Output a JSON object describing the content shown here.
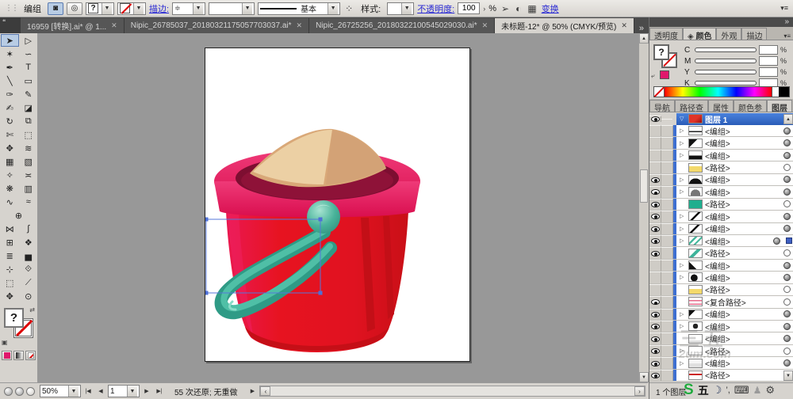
{
  "colors": {
    "accent_blue": "#316ac5",
    "link_blue": "#2a2ad4",
    "tab_dark": "#4b4b4b",
    "panel_bg": "#d6d3ce",
    "selected_row_blue": "#2a5cb8",
    "canvas_gray": "#989898",
    "bucket_red": "#e6131f",
    "rim_pink": "#e41158",
    "handle_teal": "#3fae96",
    "sand_tan": "#e3bd8e",
    "swatch_magenta": "#e0186c"
  },
  "control_bar": {
    "grip": "⋮⋮",
    "selection_label": "编组",
    "fill_proxy": "?",
    "stroke_link": "描边:",
    "stroke_weight_icon": "≑",
    "brush_name": "基本",
    "dots_icon": "⁘",
    "style_label": "样式:",
    "opacity_link": "不透明度:",
    "opacity_value": "100",
    "opacity_stepper": "›",
    "percent": "%",
    "pointer_icon": "➢",
    "sphere_icon": "◐",
    "checker_icon": "▦",
    "transform_link": "变换",
    "menu_icon": "▾≡"
  },
  "tab_bar": {
    "stub": "❝",
    "overflow": "»",
    "close_glyph": "✕",
    "documents": [
      {
        "label": "16959 [转换].ai* @ 1...",
        "active": false
      },
      {
        "label": "Nipic_26785037_20180321175057703037.ai*",
        "active": false
      },
      {
        "label": "Nipic_26725256_20180322100545029030.ai*",
        "active": false
      },
      {
        "label": "未标题-12* @ 50% (CMYK/预览)",
        "active": true
      }
    ]
  },
  "toolbar": {
    "rows": [
      {
        "left": {
          "name": "selection-tool",
          "glyph": "➤",
          "active": true
        },
        "right": {
          "name": "direct-selection-tool",
          "glyph": "▷"
        }
      },
      {
        "left": {
          "name": "magic-wand-tool",
          "glyph": "✶"
        },
        "right": {
          "name": "lasso-tool",
          "glyph": "∽"
        }
      },
      {
        "left": {
          "name": "pen-tool",
          "glyph": "✒"
        },
        "right": {
          "name": "type-tool",
          "glyph": "T"
        }
      },
      {
        "left": {
          "name": "line-segment-tool",
          "glyph": "╲"
        },
        "right": {
          "name": "rectangle-tool",
          "glyph": "▭"
        }
      },
      {
        "left": {
          "name": "paintbrush-tool",
          "glyph": "✑"
        },
        "right": {
          "name": "pencil-tool",
          "glyph": "✎"
        }
      },
      {
        "left": {
          "name": "blob-brush-tool",
          "glyph": "✍"
        },
        "right": {
          "name": "eraser-tool",
          "glyph": "◪"
        }
      },
      {
        "left": {
          "name": "rotate-tool",
          "glyph": "↻"
        },
        "right": {
          "name": "reflect-tool",
          "glyph": "⧉"
        }
      },
      {
        "left": {
          "name": "scissors-tool",
          "glyph": "✄"
        },
        "right": {
          "name": "free-transform-tool",
          "glyph": "⬚"
        }
      },
      {
        "left": {
          "name": "warp-tool",
          "glyph": "✥"
        },
        "right": {
          "name": "width-tool",
          "glyph": "≋"
        }
      },
      {
        "left": {
          "name": "mesh-tool",
          "glyph": "▦"
        },
        "right": {
          "name": "gradient-tool",
          "glyph": "▧"
        }
      },
      {
        "left": {
          "name": "eyedropper-tool",
          "glyph": "✧"
        },
        "right": {
          "name": "blend-tool",
          "glyph": "≍"
        }
      },
      {
        "left": {
          "name": "symbol-sprayer-tool",
          "glyph": "❋"
        },
        "right": {
          "name": "column-graph-tool",
          "glyph": "▥"
        }
      },
      {
        "left": {
          "name": "knife-tool",
          "glyph": "∿"
        },
        "right": {
          "name": "wave-tool",
          "glyph": "≈"
        }
      },
      {
        "single": {
          "name": "crosshair-tool",
          "glyph": "⊕"
        }
      },
      {
        "left": {
          "name": "envelope-tool",
          "glyph": "⋈"
        },
        "right": {
          "name": "arc-tool",
          "glyph": "∫"
        }
      },
      {
        "left": {
          "name": "grid-tool",
          "glyph": "⊞"
        },
        "right": {
          "name": "shape-builder-tool",
          "glyph": "❖"
        }
      },
      {
        "left": {
          "name": "scribble-tool",
          "glyph": "≣"
        },
        "right": {
          "name": "bar-graph-tool",
          "glyph": "▅"
        }
      },
      {
        "left": {
          "name": "measure-tool",
          "glyph": "⊹"
        },
        "right": {
          "name": "live-paint-tool",
          "glyph": "⟐"
        }
      },
      {
        "left": {
          "name": "marquee-tool",
          "glyph": "⬚"
        },
        "right": {
          "name": "slice-tool",
          "glyph": "⟋"
        }
      },
      {
        "left": {
          "name": "hand-tool",
          "glyph": "✥"
        },
        "right": {
          "name": "zoom-tool",
          "glyph": "⊙"
        }
      }
    ],
    "fill_proxy": "?",
    "swap_icon": "⇄",
    "mini_icon": "▣"
  },
  "statusbar": {
    "zoom_value": "50%",
    "nav_first": "|◀",
    "nav_prev": "◀",
    "artboard_value": "1",
    "nav_next": "▶",
    "nav_last": "▶|",
    "status_text": "55 次还原; 无重做",
    "status_more": "▶",
    "hscroll_left": "‹",
    "hscroll_right": "›",
    "vscroll_up": "▲",
    "vscroll_down": "▼"
  },
  "dock": {
    "overflow": "»",
    "menu_icon": "▾≡",
    "group1_tabs": [
      {
        "label": "透明度",
        "active": false
      },
      {
        "label": "颜色",
        "active": true,
        "icon": "◈"
      },
      {
        "label": "外观",
        "active": false
      },
      {
        "label": "描边",
        "active": false
      }
    ],
    "color_panel": {
      "fill_proxy": "?",
      "swap_icon": "⤶",
      "channels": [
        {
          "label": "C",
          "value": "",
          "unit": "%"
        },
        {
          "label": "M",
          "value": "",
          "unit": "%"
        },
        {
          "label": "Y",
          "value": "",
          "unit": "%"
        },
        {
          "label": "K",
          "value": "",
          "unit": "%"
        }
      ]
    },
    "group2_tabs": [
      {
        "label": "导航",
        "active": false
      },
      {
        "label": "路径查",
        "active": false
      },
      {
        "label": "属性",
        "active": false
      },
      {
        "label": "颜色参",
        "active": false
      },
      {
        "label": "图层",
        "active": true
      }
    ],
    "layers": {
      "header": {
        "name": "图层 1",
        "expand": "▽"
      },
      "expand_glyph": "▷",
      "items": [
        {
          "label": "<编组>",
          "eye": false,
          "expand": true,
          "thumb": "white-line",
          "target": "filled"
        },
        {
          "label": "<编组>",
          "eye": false,
          "expand": true,
          "thumb": "black-wedge",
          "target": "filled"
        },
        {
          "label": "<编组>",
          "eye": false,
          "expand": true,
          "thumb": "black-bottom",
          "target": "filled"
        },
        {
          "label": "<路径>",
          "eye": false,
          "expand": false,
          "thumb": "yellow",
          "target": "open"
        },
        {
          "label": "<编组>",
          "eye": true,
          "expand": true,
          "thumb": "black-crescent",
          "target": "filled"
        },
        {
          "label": "<编组>",
          "eye": true,
          "expand": true,
          "thumb": "gray-blob",
          "target": "filled"
        },
        {
          "label": "<路径>",
          "eye": true,
          "expand": false,
          "thumb": "teal",
          "target": "open"
        },
        {
          "label": "<编组>",
          "eye": true,
          "expand": true,
          "thumb": "diag-line",
          "target": "filled"
        },
        {
          "label": "<编组>",
          "eye": true,
          "expand": true,
          "thumb": "diag-line2",
          "target": "filled"
        },
        {
          "label": "<编组>",
          "eye": true,
          "expand": true,
          "thumb": "teal-marks",
          "target": "filled",
          "selected": true
        },
        {
          "label": "<路径>",
          "eye": true,
          "expand": false,
          "thumb": "teal-diag",
          "target": "open"
        },
        {
          "label": "<编组>",
          "eye": false,
          "expand": true,
          "thumb": "black-wedge2",
          "target": "filled"
        },
        {
          "label": "<编组>",
          "eye": false,
          "expand": true,
          "thumb": "black-blob",
          "target": "filled"
        },
        {
          "label": "<路径>",
          "eye": false,
          "expand": false,
          "thumb": "yellow2",
          "target": "open"
        },
        {
          "label": "<复合路径>",
          "eye": true,
          "expand": false,
          "thumb": "pink-lines",
          "target": "open"
        },
        {
          "label": "<编组>",
          "eye": true,
          "expand": true,
          "thumb": "black-wedge3",
          "target": "filled"
        },
        {
          "label": "<编组>",
          "eye": true,
          "expand": true,
          "thumb": "black-blob2",
          "target": "filled"
        },
        {
          "label": "<编组>",
          "eye": true,
          "expand": false,
          "thumb": "outline",
          "target": "filled"
        },
        {
          "label": "<路径>",
          "eye": true,
          "expand": true,
          "thumb": "outline2",
          "target": "open"
        },
        {
          "label": "<编组>",
          "eye": true,
          "expand": true,
          "thumb": "outline3",
          "target": "filled"
        },
        {
          "label": "<路径>",
          "eye": true,
          "expand": false,
          "thumb": "red-line",
          "target": "open"
        }
      ],
      "footer": "1 个图层"
    },
    "thumb_styles": {
      "red-layer": "linear-gradient(135deg,#e03428 55%,#9c0d0d 100%)",
      "white-line": "linear-gradient(180deg,#fff 55%,#222 55%,#222 72%,#fff 72%)",
      "black-wedge": "linear-gradient(135deg,#111 40%,#fff 40%)",
      "black-bottom": "linear-gradient(180deg,#fff 55%,#111 55%)",
      "yellow": "linear-gradient(180deg,#fff 30%,#f3d96b 30%)",
      "black-crescent": "radial-gradient(circle at 50% 115%,#111 58%,#fff 59%)",
      "gray-blob": "radial-gradient(circle at 50% 85%,#777 52%,#fff 53%)",
      "teal": "linear-gradient(#1fae8e,#1fae8e)",
      "diag-line": "linear-gradient(135deg,#fff 44%,#111 44%,#111 56%,#fff 56%)",
      "diag-line2": "linear-gradient(135deg,#fff 40%,#111 40%,#111 52%,#fff 52%)",
      "teal-marks": "linear-gradient(135deg,#fff 28%,#49b89e 28%,#49b89e 42%,#fff 42%,#fff 58%,#49b89e 58%,#49b89e 70%,#fff 70%)",
      "teal-diag": "linear-gradient(135deg,#fff 38%,#3db39a 38%,#3db39a 58%,#fff 58%)",
      "black-wedge2": "linear-gradient(45deg,#111 35%,#fff 35%)",
      "black-blob": "radial-gradient(circle at 40% 60%,#111 38%,#fff 39%)",
      "yellow2": "linear-gradient(180deg,#fff 40%,#f3d96b 40%)",
      "pink-lines": "repeating-linear-gradient(180deg,#fff 0 3px,#e66a8a 3px 4.5px)",
      "black-wedge3": "linear-gradient(135deg,#111 30%,#fff 30%)",
      "black-blob2": "radial-gradient(circle at 50% 50%,#222 34%,#fff 35%)",
      "outline": "linear-gradient(180deg,#fff 70%,#ddd 70%)",
      "outline2": "linear-gradient(#fff,#fff)",
      "outline3": "linear-gradient(180deg,#f5f5f5 50%,#e0e0e0 50%)",
      "red-line": "linear-gradient(180deg,#fff 32%,#c22 32%,#c22 48%,#fff 48%)"
    }
  },
  "ime_bar": {
    "logo": "S",
    "wubi": "五",
    "moon": "☽",
    "dots": "’,",
    "keyboard": "⌨",
    "person": "♟",
    "wrench": "⚙"
  },
  "watermark": {
    "line1": "三五",
    "line2": "2um.com"
  }
}
